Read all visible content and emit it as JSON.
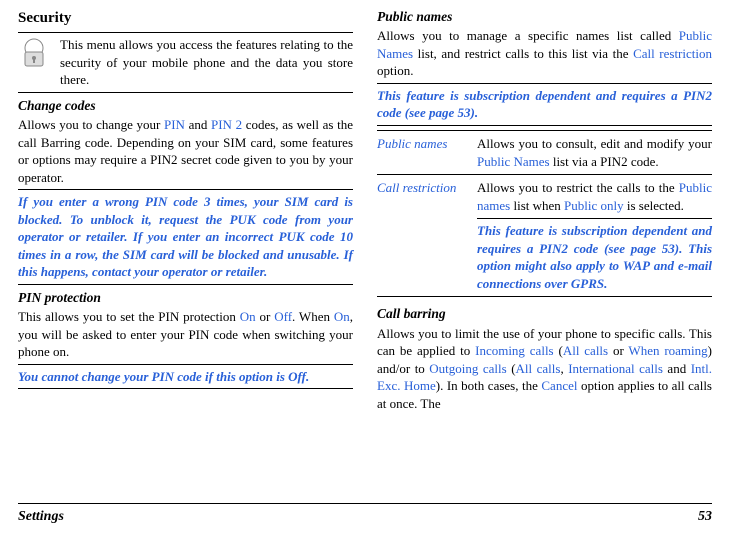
{
  "left": {
    "title": "Security",
    "intro": "This menu allows you access the features relating to the security of your mobile phone and the data you store there.",
    "change_codes": {
      "title": "Change codes",
      "p1a": "Allows you to change your ",
      "pin": "PIN",
      "p1b": " and ",
      "pin2": "PIN 2",
      "p1c": " codes, as well as the call Barring code. Depending on your SIM card, some features or options may require a PIN2 secret code given to you by your operator."
    },
    "warn1": "If you enter a wrong PIN code 3 times, your SIM card is blocked. To unblock it, request the PUK code from your operator or retailer. If you enter an incorrect PUK code 10 times in a row, the SIM card will be blocked and unusable. If this happens, contact your operator or retailer.",
    "pin_prot": {
      "title": "PIN protection",
      "p1a": "This allows you to set the PIN protection ",
      "on": "On",
      "p1b": " or ",
      "off": "Off",
      "p1c": ". When ",
      "on2": "On",
      "p1d": ", you will be asked to enter your PIN code when switching your phone on."
    },
    "warn2a": "You cannot change your PIN code if this option is ",
    "warn2off": "Off",
    "warn2b": "."
  },
  "right": {
    "public_names": {
      "title": "Public names",
      "p1a": "Allows you to manage a specific names list called ",
      "pn": "Public Names",
      "p1b": " list, and restrict calls to this list via the ",
      "cr": "Call restriction",
      "p1c": " option."
    },
    "warn": "This feature is subscription dependent and requires a PIN2 code (see page 53).",
    "table": {
      "row1": {
        "label": "Public names",
        "t1": "Allows you to consult, edit and modify your ",
        "pn": "Public Names",
        "t2": " list via a PIN2 code."
      },
      "row2": {
        "label": "Call restriction",
        "t1": "Allows you to restrict the calls to the ",
        "pn": "Public names",
        "t2": " list when ",
        "po": "Public only",
        "t3": " is selected.",
        "note": "This feature is subscription dependent and requires a PIN2 code (see page 53). This option might also apply to WAP and e-mail connections over GPRS."
      }
    },
    "call_barring": {
      "title": "Call barring",
      "p1a": "Allows you to limit the use of your phone to specific calls. This can be applied to ",
      "ic": "Incoming calls",
      "p1b": " (",
      "ac": "All calls",
      "p1c": " or ",
      "wr": "When roaming",
      "p1d": ") and/or to ",
      "oc": "Outgoing calls",
      "p1e": " (",
      "ac2": "All calls",
      "p1f": ", ",
      "intl": "International calls",
      "p1g": " and ",
      "ieh": "Intl. Exc. Home",
      "p1h": "). In both cases, the ",
      "cancel": "Cancel",
      "p1i": " option applies to all calls at once. The"
    }
  },
  "footer": {
    "section": "Settings",
    "page": "53"
  }
}
